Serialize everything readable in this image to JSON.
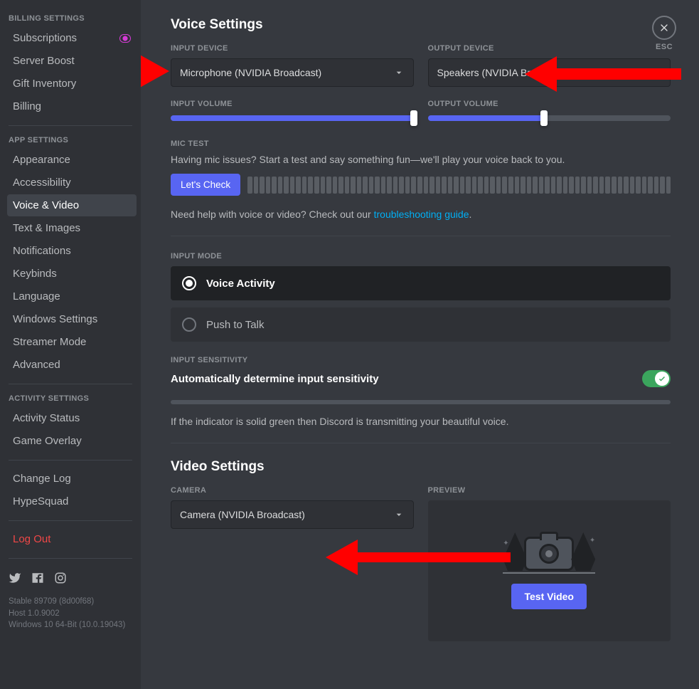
{
  "sidebar": {
    "billing_header": "BILLING SETTINGS",
    "billing_items": [
      {
        "label": "Subscriptions",
        "badge": true
      },
      {
        "label": "Server Boost"
      },
      {
        "label": "Gift Inventory"
      },
      {
        "label": "Billing"
      }
    ],
    "app_header": "APP SETTINGS",
    "app_items": [
      {
        "label": "Appearance"
      },
      {
        "label": "Accessibility"
      },
      {
        "label": "Voice & Video",
        "active": true
      },
      {
        "label": "Text & Images"
      },
      {
        "label": "Notifications"
      },
      {
        "label": "Keybinds"
      },
      {
        "label": "Language"
      },
      {
        "label": "Windows Settings"
      },
      {
        "label": "Streamer Mode"
      },
      {
        "label": "Advanced"
      }
    ],
    "activity_header": "ACTIVITY SETTINGS",
    "activity_items": [
      {
        "label": "Activity Status"
      },
      {
        "label": "Game Overlay"
      }
    ],
    "misc_items": [
      {
        "label": "Change Log"
      },
      {
        "label": "HypeSquad"
      }
    ],
    "logout": "Log Out",
    "meta_lines": [
      "Stable 89709 (8d00f68)",
      "Host 1.0.9002",
      "Windows 10 64-Bit (10.0.19043)"
    ]
  },
  "close": {
    "esc": "ESC"
  },
  "voice": {
    "heading": "Voice Settings",
    "input_device_label": "INPUT DEVICE",
    "input_device_value": "Microphone (NVIDIA Broadcast)",
    "output_device_label": "OUTPUT DEVICE",
    "output_device_value": "Speakers (NVIDIA Broadcast)",
    "input_volume_label": "INPUT VOLUME",
    "input_volume_percent": 100,
    "output_volume_label": "OUTPUT VOLUME",
    "output_volume_percent": 48,
    "mic_test_label": "MIC TEST",
    "mic_test_desc": "Having mic issues? Start a test and say something fun—we'll play your voice back to you.",
    "lets_check": "Let's Check",
    "help_prefix": "Need help with voice or video? Check out our ",
    "help_link": "troubleshooting guide",
    "help_suffix": ".",
    "input_mode_label": "INPUT MODE",
    "mode_voice_activity": "Voice Activity",
    "mode_push_to_talk": "Push to Talk",
    "input_sensitivity_label": "INPUT SENSITIVITY",
    "auto_sensitivity_label": "Automatically determine input sensitivity",
    "auto_sensitivity_on": true,
    "sensitivity_desc": "If the indicator is solid green then Discord is transmitting your beautiful voice."
  },
  "video": {
    "heading": "Video Settings",
    "camera_label": "CAMERA",
    "camera_value": "Camera (NVIDIA Broadcast)",
    "preview_label": "PREVIEW",
    "test_video": "Test Video"
  }
}
